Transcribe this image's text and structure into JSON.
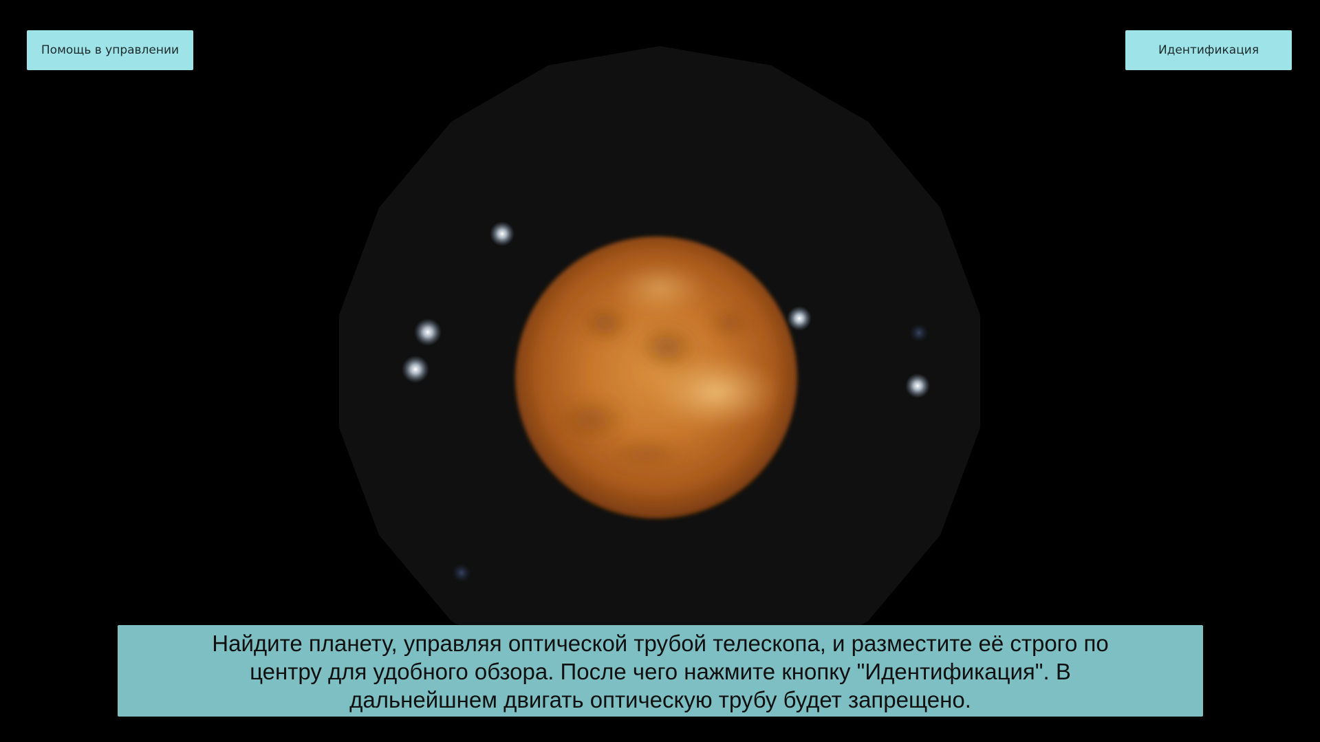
{
  "header": {
    "help_button_label": "Помощь в управлении",
    "identify_button_label": "Идентификация"
  },
  "view": {
    "background_color": "#000000",
    "eyepiece_color": "#101010",
    "planet_color": "#c8732a",
    "star_color": "#dfe8f2"
  },
  "hint": {
    "text": "Найдите планету, управляя оптической трубой телескопа, и разместите её строго по центру для удобного обзора. После чего нажмите кнопку \"Идентификация\". В дальнейшнем двигать оптическую трубу будет запрещено."
  },
  "colors": {
    "button_bg": "#9de3e8",
    "hint_bg": "#7dbfc3"
  }
}
